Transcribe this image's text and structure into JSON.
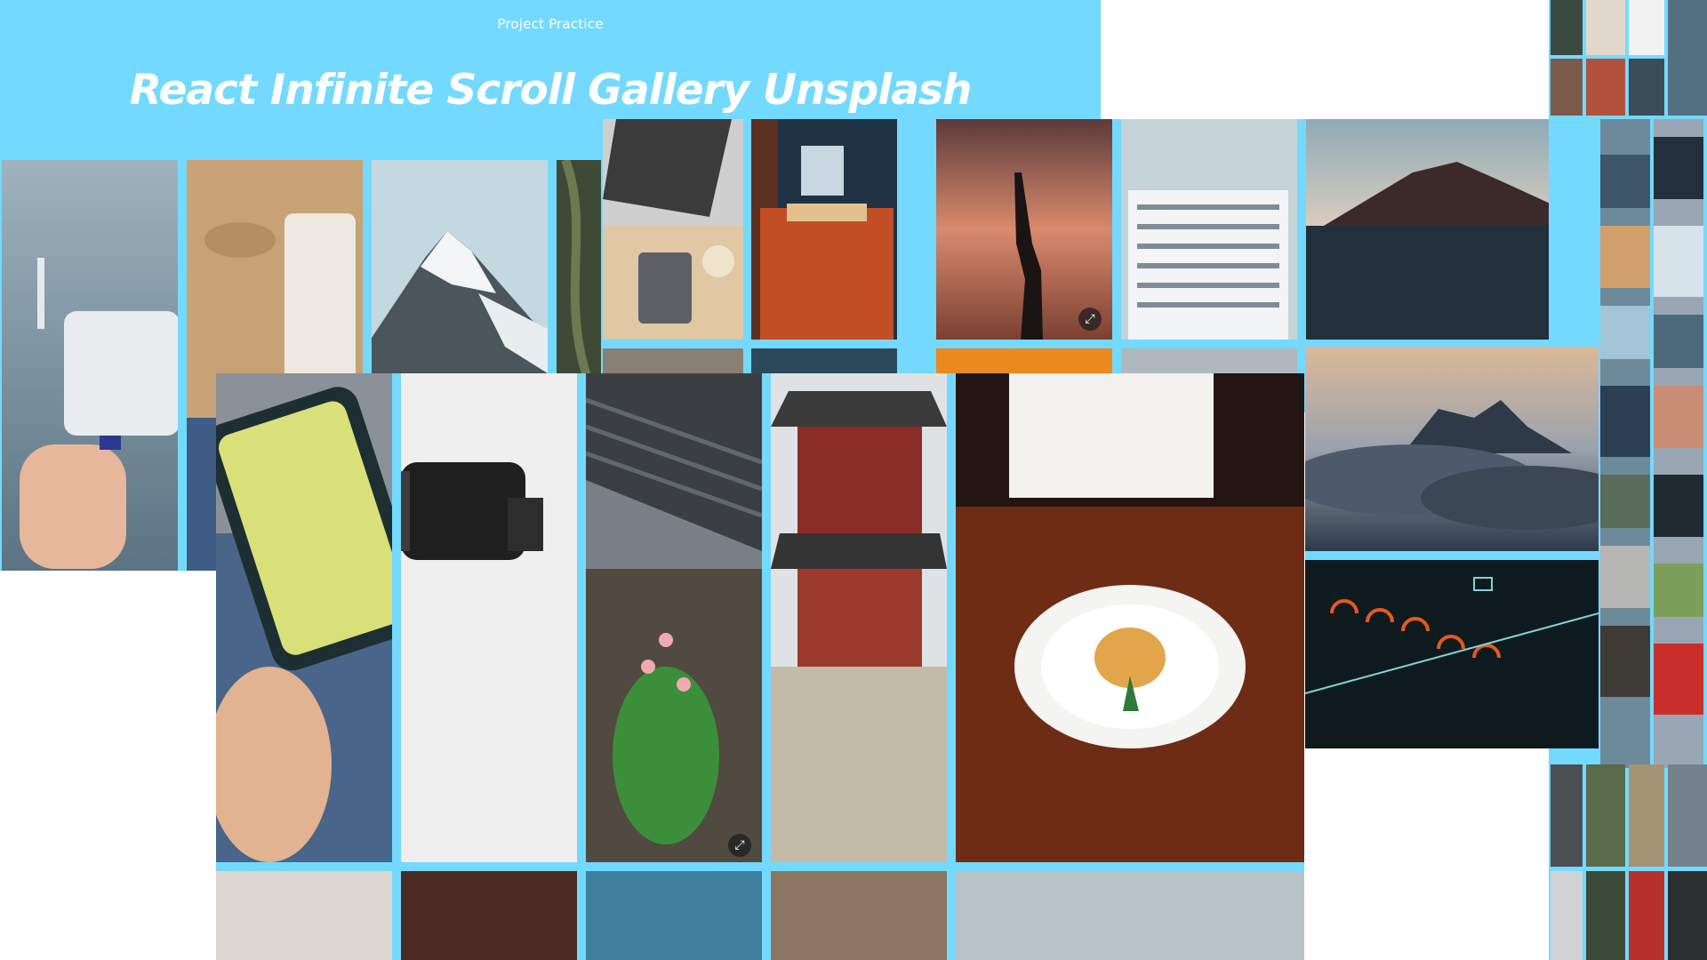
{
  "header": {
    "eyebrow": "Project Practice",
    "title": "React Infinite Scroll Gallery Unsplash"
  },
  "colors": {
    "accent": "#74d9ff",
    "background": "#ffffff"
  },
  "photos": [
    "drone-battery-photo",
    "sand-towel-photo",
    "snow-mountain-photo",
    "laptop-desk-photo",
    "orange-bedroom-photo",
    "sunset-hand-photo",
    "white-building-photo",
    "volcano-lake-photo",
    "phone-in-hand-photo",
    "camera-lens-photo",
    "hanok-roof-photo",
    "pagoda-temple-photo",
    "plated-dish-photo",
    "cloud-peaks-photo",
    "synth-screen-photo"
  ],
  "icons": {
    "expand": "expand-icon"
  }
}
